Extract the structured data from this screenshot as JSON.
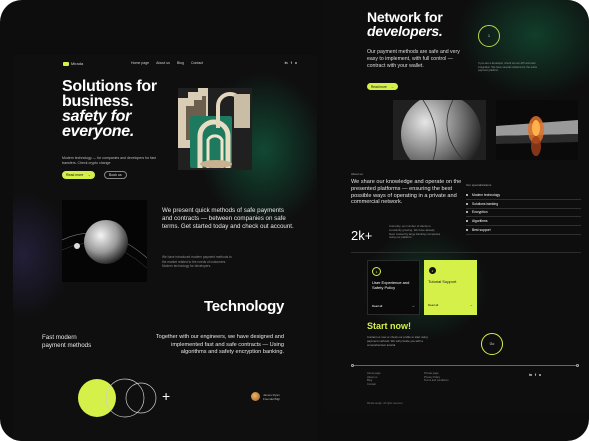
{
  "left": {
    "nav": {
      "logo": "Mirada",
      "links": [
        "Home page",
        "About us",
        "Blog",
        "Contact"
      ],
      "social": [
        "in",
        "f",
        "o"
      ]
    },
    "hero": {
      "title_line1": "Solutions for",
      "title_line2": "business.",
      "title_line3": "safety for",
      "title_line4": "everyone.",
      "subtitle": "Modern technology — for companies and developers for fast transfers. Check crypto change",
      "primary_button": "Read more",
      "secondary_button": "Book us"
    },
    "present": {
      "text": "We present quick methods of safe payments and contracts — between companies on safe terms. Get started today and check out account.",
      "small": "We have introduced modern payment methods to the market related to the needs of customers. Modern technology for developers."
    },
    "technology": {
      "title": "Technology",
      "left_text": "Fast modern payment methods",
      "right_text": "Together with our engineers, we have designed and implemented fast and safe contracts — Using algorithms and safety encryption banking."
    },
    "author": {
      "name": "James Ryan",
      "role": "Founder/Mgr"
    }
  },
  "right": {
    "network": {
      "title_line1": "Network for",
      "title_line2": "developers.",
      "description": "Our payment methods are safe and very easy to implement, with full control — contract with your wallet.",
      "button": "Read more",
      "badge": "1",
      "small": "If you are a developer, check out our API and start integration. We have several solutions for the entire payment platform."
    },
    "about": {
      "label": "About us",
      "text": "We share our knowledge and operate on the presented platforms — ensuring the best possible ways of operating in a private and commercial network."
    },
    "specs": {
      "label": "Our specializations",
      "items": [
        "Modern technology",
        "Solutions banking",
        "Encryption",
        "Algorithms",
        "Best support"
      ]
    },
    "stats": {
      "number": "2k+",
      "description": "Currently, our number of clients is constantly growing. We have already been trusted by large banking companies using our platform."
    },
    "cards": [
      {
        "icon": "1",
        "title": "User Experience and Safety Policy",
        "link": "Read all"
      },
      {
        "icon": "2",
        "title": "Tutorial Support",
        "link": "Read all"
      }
    ],
    "start": {
      "title": "Start now!",
      "description": "Contact us now or check our profile to start using payment methods. We will provide you with a comprehensive tutorial.",
      "badge": "Go"
    },
    "footer": {
      "col1": [
        "Home page",
        "About us",
        "Blog",
        "Contact"
      ],
      "col2": [
        "Private page",
        "Privacy Policy",
        "Terms and conditions"
      ],
      "social": [
        "in",
        "f",
        "o"
      ],
      "copyright": "Mirada design. All rights reserved."
    }
  },
  "colors": {
    "accent": "#d6f04a",
    "background": "#0d0d0e"
  }
}
